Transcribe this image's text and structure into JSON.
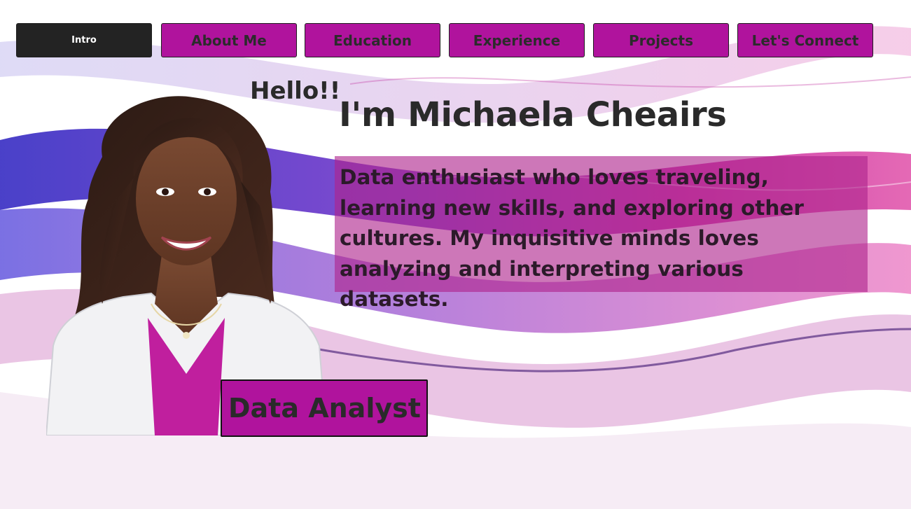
{
  "nav": {
    "items": [
      {
        "label": "Intro",
        "active": true
      },
      {
        "label": "About Me",
        "active": false
      },
      {
        "label": "Education",
        "active": false
      },
      {
        "label": "Experience",
        "active": false
      },
      {
        "label": "Projects",
        "active": false
      },
      {
        "label": "Let's Connect",
        "active": false
      }
    ]
  },
  "hero": {
    "greeting": "Hello!!",
    "name": "I'm Michaela Cheairs",
    "bio": "Data enthusiast who loves traveling, learning new skills, and exploring other cultures. My inquisitive minds loves analyzing and interpreting various datasets.",
    "role": "Data Analyst"
  },
  "colors": {
    "accent": "#b0139d",
    "active_nav": "#232323",
    "text": "#2a2a2a"
  }
}
